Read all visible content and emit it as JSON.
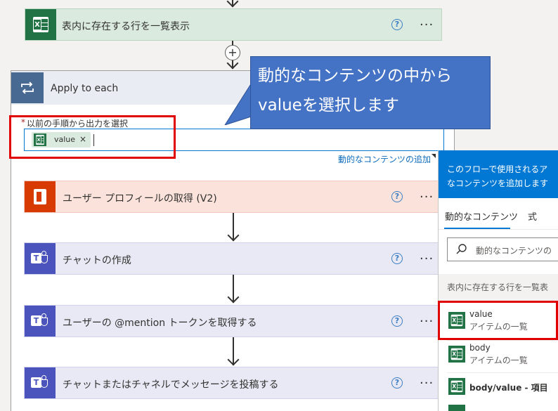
{
  "colors": {
    "excel_green": "#217346",
    "teams_purple": "#4b53bc",
    "office_orange": "#d83b01",
    "highlight_red": "#e00000",
    "callout_blue": "#4472c4",
    "link_blue": "#0f6cbd"
  },
  "steps": {
    "list_rows": {
      "title": "表内に存在する行を一覧表示",
      "icon": "excel-icon"
    },
    "apply_each": {
      "title": "Apply to each",
      "icon": "loop-icon",
      "field_label": "以前の手順から出力を選択",
      "required_mark": "*",
      "token_label": "value",
      "token_remove": "×",
      "add_dynamic_link": "動的なコンテンツの追加"
    },
    "get_profile": {
      "title": "ユーザー プロフィールの取得 (V2)",
      "icon": "office-icon"
    },
    "create_chat": {
      "title": "チャットの作成",
      "icon": "teams-icon"
    },
    "get_mention": {
      "title": "ユーザーの @mention トークンを取得する",
      "icon": "teams-icon"
    },
    "post_message": {
      "title": "チャットまたはチャネルでメッセージを投稿する",
      "icon": "teams-icon"
    }
  },
  "help_glyph": "?",
  "more_glyph": "···",
  "add_glyph": "+",
  "callout": {
    "line1": "動的なコンテンツの中から",
    "line2": "valueを選択します"
  },
  "panel": {
    "info_line1": "このフローで使用されるア",
    "info_line2": "なコンテンツを追加します",
    "tab_dynamic": "動的なコンテンツ",
    "tab_expression": "式",
    "search_placeholder": "動的なコンテンツの",
    "section_title": "表内に存在する行を一覧表",
    "items": [
      {
        "name": "value",
        "desc": "アイテムの一覧"
      },
      {
        "name": "body",
        "desc": "アイテムの一覧"
      },
      {
        "name": "body/value - 項目",
        "desc": ""
      }
    ]
  }
}
